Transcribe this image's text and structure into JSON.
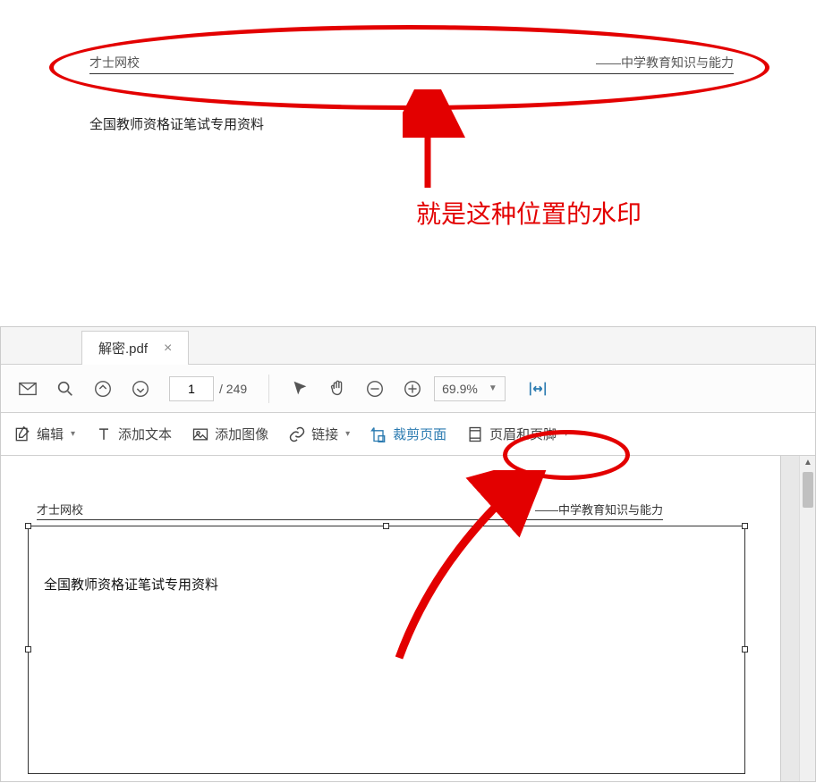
{
  "top": {
    "header_left": "才士网校",
    "header_right": "——中学教育知识与能力",
    "body_text": "全国教师资格证笔试专用资料",
    "caption": "就是这种位置的水印"
  },
  "editor": {
    "tab": {
      "title": "解密.pdf",
      "close": "×"
    },
    "toolbar": {
      "page_current": "1",
      "page_total": "/ 249",
      "zoom": "69.9%"
    },
    "sec": {
      "edit": "编辑",
      "add_text": "添加文本",
      "add_image": "添加图像",
      "link": "链接",
      "crop_page": "裁剪页面",
      "header_footer": "页眉和页脚"
    },
    "doc": {
      "header_left": "才士网校",
      "header_right": "——中学教育知识与能力",
      "body_text": "全国教师资格证笔试专用资料"
    }
  }
}
